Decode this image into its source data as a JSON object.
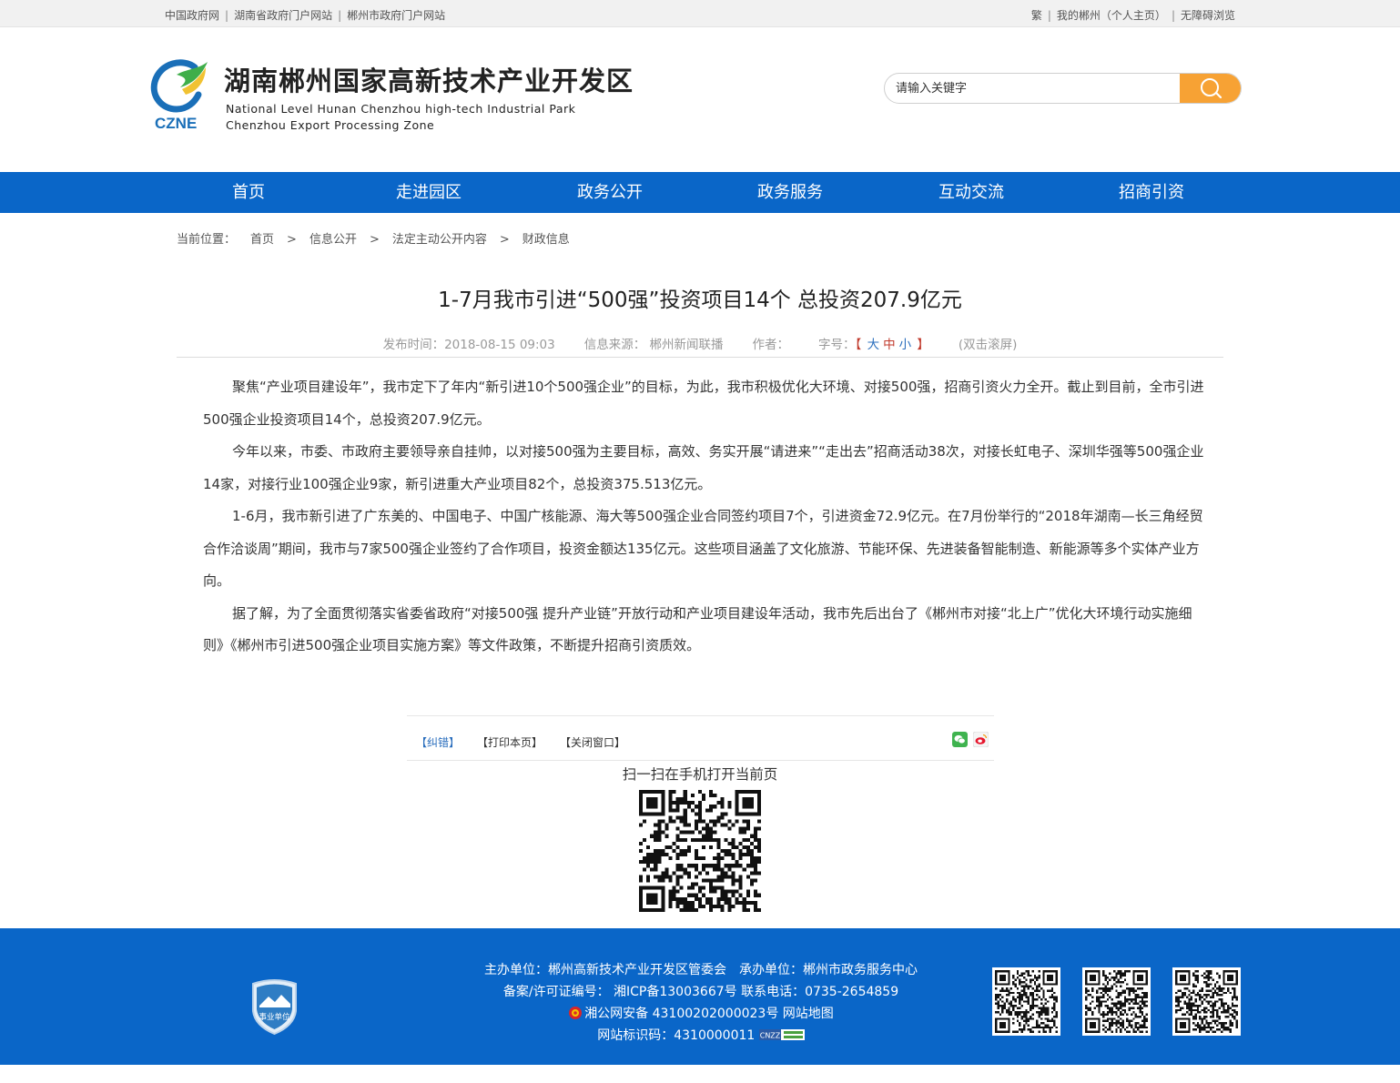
{
  "topbar": {
    "links_left": [
      "中国政府网",
      "湖南省政府门户网站",
      "郴州市政府门户网站"
    ],
    "link_trad": "繁",
    "link_my": "我的郴州（个人主页）",
    "link_access": "无障碍浏览"
  },
  "header": {
    "logo_text": "CZNE",
    "title": "湖南郴州国家高新技术产业开发区",
    "en_line1": "National  Level  Hunan  Chenzhou high-tech  Industrial  Park",
    "en_line2": "Chenzhou  Export  Processing  Zone",
    "search_placeholder": "请输入关键字"
  },
  "nav": [
    "首页",
    "走进园区",
    "政务公开",
    "政务服务",
    "互动交流",
    "招商引资"
  ],
  "breadcrumb": {
    "label": "当前位置：",
    "items": [
      "首页",
      "信息公开",
      "法定主动公开内容",
      "财政信息"
    ]
  },
  "article": {
    "title": "1-7月我市引进“500强”投资项目14个 总投资207.9亿元",
    "publish": "发布时间：2018-08-15 09:03",
    "source": "信息来源： 郴州新闻联播",
    "author": "作者：",
    "fontsize_label": "字号：",
    "fs_open": "【",
    "fs_large": "大",
    "fs_mid": "中",
    "fs_small": "小",
    "fs_close": "】",
    "dblclick": "(双击滚屏)",
    "paragraphs": [
      "聚焦“产业项目建设年”，我市定下了年内“新引进10个500强企业”的目标，为此，我市积极优化大环境、对接500强，招商引资火力全开。截止到目前，全市引进500强企业投资项目14个，总投资207.9亿元。",
      "今年以来，市委、市政府主要领导亲自挂帅，以对接500强为主要目标，高效、务实开展“请进来”“走出去”招商活动38次，对接长虹电子、深圳华强等500强企业14家，对接行业100强企业9家，新引进重大产业项目82个，总投资375.513亿元。",
      "1-6月，我市新引进了广东美的、中国电子、中国广核能源、海大等500强企业合同签约项目7个，引进资金72.9亿元。在7月份举行的“2018年湖南—长三角经贸合作洽谈周”期间，我市与7家500强企业签约了合作项目，投资金额达135亿元。这些项目涵盖了文化旅游、节能环保、先进装备智能制造、新能源等多个实体产业方向。",
      "据了解，为了全面贯彻落实省委省政府“对接500强 提升产业链”开放行动和产业项目建设年活动，我市先后出台了《郴州市对接“北上广”优化大环境行动实施细则》《郴州市引进500强企业项目实施方案》等文件政策，不断提升招商引资质效。"
    ]
  },
  "share": {
    "correct": "【纠错】",
    "print": "【打印本页】",
    "close": "【关闭窗口】",
    "qr_caption": "扫一扫在手机打开当前页"
  },
  "footer": {
    "badge_text": "事业单位",
    "line1": "主办单位：郴州高新技术产业开发区管委会　承办单位：郴州市政务服务中心",
    "line2": "备案/许可证编号： 湘ICP备13003667号 联系电话：0735-2654859",
    "line3": "湘公网安备 43100202000023号 网站地图",
    "line4": "网站标识码：4310000011",
    "cnzz": "CNZZ"
  },
  "colors": {
    "nav_blue": "#0a66c8",
    "search_orange": "#f7a234",
    "logo_blue": "#1a6fb8",
    "logo_green": "#3fae4a"
  }
}
